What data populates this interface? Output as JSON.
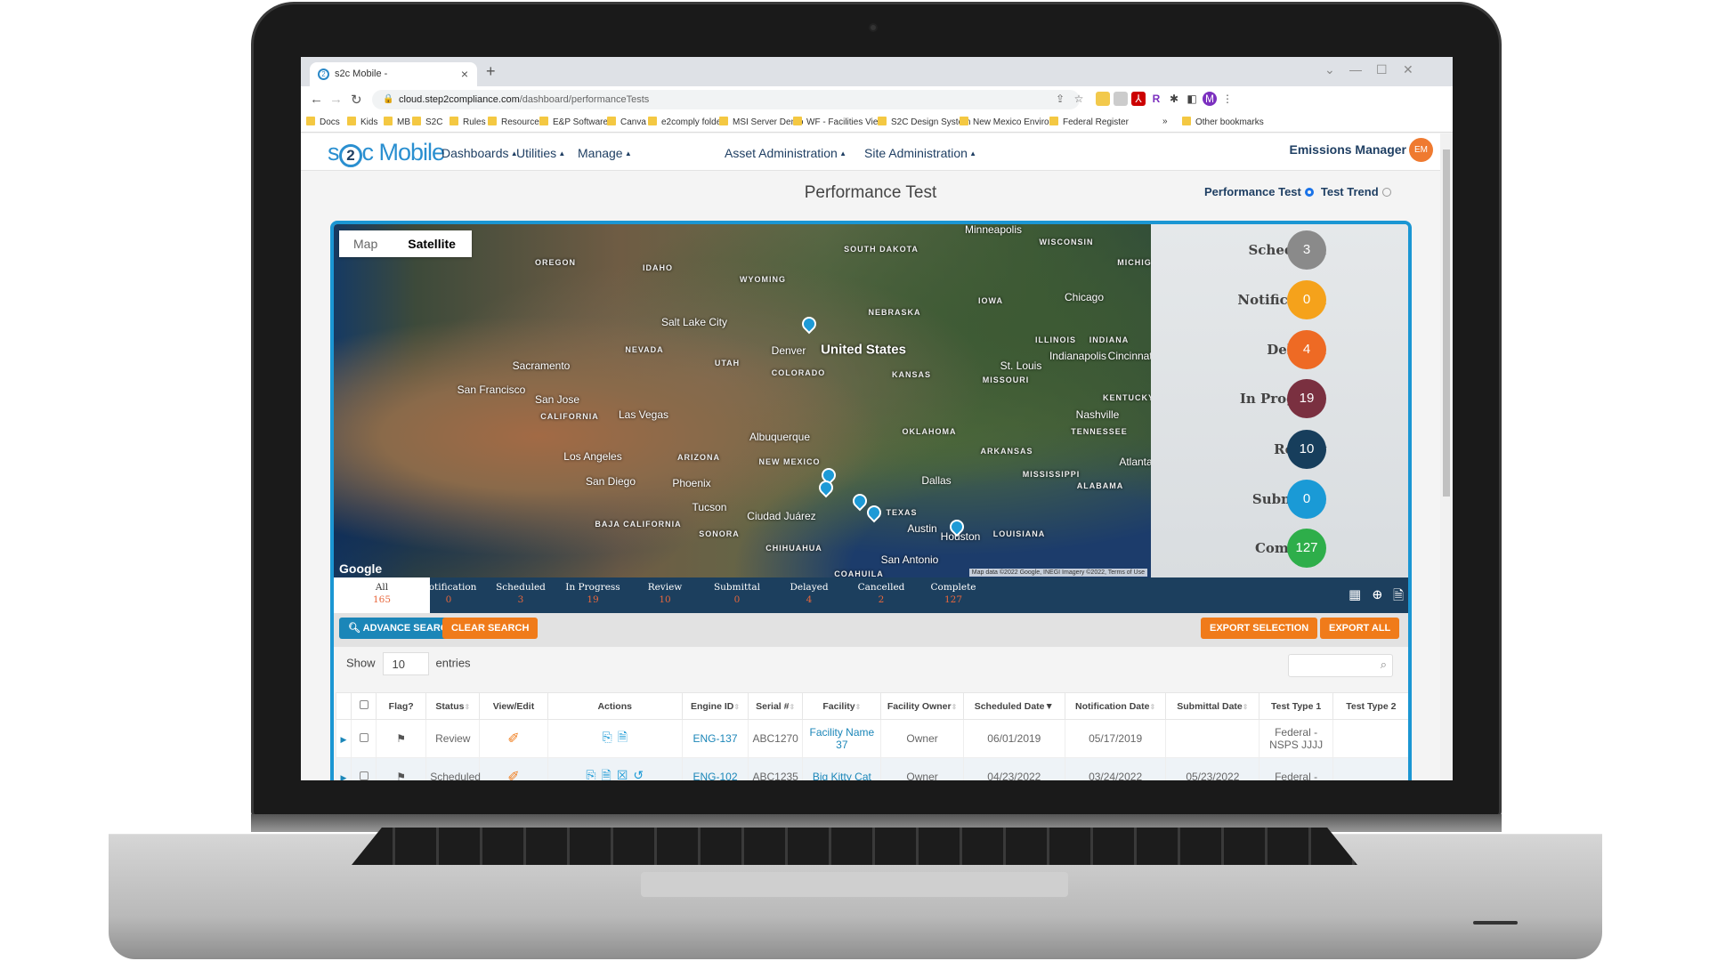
{
  "browser": {
    "tab_title": "s2c Mobile -",
    "url_domain": "cloud.step2compliance.com",
    "url_path": "/dashboard/performanceTests",
    "profile_initial": "M",
    "bookmarks": [
      "Docs",
      "Kids",
      "MB",
      "S2C",
      "Rules",
      "Resources",
      "E&P Software",
      "Canva",
      "e2comply folder",
      "MSI Server Demo",
      "WF - Facilities View",
      "S2C Design System",
      "New Mexico Enviro...",
      "Federal Register"
    ],
    "more": "»",
    "other_bookmarks": "Other bookmarks"
  },
  "app": {
    "logo_left": "s",
    "logo_mid": "2",
    "logo_right": "c Mobile",
    "nav": [
      "Dashboards",
      "Utilities",
      "Manage",
      "Asset Administration",
      "Site Administration"
    ],
    "user": "Emissions Manager",
    "avatar": "EM"
  },
  "page": {
    "title": "Performance Test",
    "view_options": [
      {
        "label": "Performance Test",
        "selected": true
      },
      {
        "label": "Test Trend",
        "selected": false
      }
    ]
  },
  "map": {
    "toggle": [
      "Map",
      "Satellite"
    ],
    "active_toggle": "Satellite",
    "attribution": "Google",
    "terms": "Map data ©2022 Google, INEGI Imagery ©2022, Terms of Use",
    "labels": [
      "United States",
      "Denver",
      "Sacramento",
      "San Francisco",
      "San Jose",
      "Las Vegas",
      "Los Angeles",
      "San Diego",
      "Phoenix",
      "Tucson",
      "Albuquerque",
      "Ciudad Juárez",
      "Dallas",
      "Austin",
      "San Antonio",
      "Houston",
      "Chicago",
      "St. Louis",
      "Indianapolis",
      "Nashville",
      "Atlanta",
      "Minneapolis",
      "Salt Lake City",
      "Cincinnati"
    ],
    "regions": [
      "OREGON",
      "IDAHO",
      "WYOMING",
      "SOUTH DAKOTA",
      "NEBRASKA",
      "IOWA",
      "WISCONSIN",
      "MICHIGAN",
      "ILLINOIS",
      "INDIANA",
      "NEVADA",
      "UTAH",
      "COLORADO",
      "KANSAS",
      "MISSOURI",
      "KENTUCKY",
      "CALIFORNIA",
      "OKLAHOMA",
      "TENNESSEE",
      "ARIZONA",
      "NEW MEXICO",
      "ARKANSAS",
      "MISSISSIPPI",
      "ALABAMA",
      "TEXAS",
      "LOUISIANA",
      "SONORA",
      "CHIHUAHUA",
      "COAHUILA",
      "BAJA CALIFORNIA"
    ],
    "pin_icon": "facility-pin-icon"
  },
  "stats": [
    {
      "label": "Scheduled",
      "count": "3",
      "color": "#8a8a8a"
    },
    {
      "label": "Notification",
      "count": "0",
      "color": "#f5a21b"
    },
    {
      "label": "Delayed",
      "count": "4",
      "color": "#ee6a24"
    },
    {
      "label": "In Progress",
      "count": "19",
      "color": "#7a3040"
    },
    {
      "label": "Review",
      "count": "10",
      "color": "#173e5c"
    },
    {
      "label": "Submittal",
      "count": "0",
      "color": "#1a9ad6"
    },
    {
      "label": "Complete",
      "count": "127",
      "color": "#2eae4a"
    }
  ],
  "filter_tabs": [
    {
      "label": "All",
      "count": "165"
    },
    {
      "label": "Notification",
      "count": "0"
    },
    {
      "label": "Scheduled",
      "count": "3"
    },
    {
      "label": "In Progress",
      "count": "19"
    },
    {
      "label": "Review",
      "count": "10"
    },
    {
      "label": "Submittal",
      "count": "0"
    },
    {
      "label": "Delayed",
      "count": "4"
    },
    {
      "label": "Cancelled",
      "count": "2"
    },
    {
      "label": "Complete",
      "count": "127"
    }
  ],
  "toolbar": {
    "advance_search": "ADVANCE SEARCH",
    "clear_search": "CLEAR SEARCH",
    "export_selection": "EXPORT SELECTION",
    "export_all": "EXPORT ALL",
    "show": "Show",
    "entries_value": "10",
    "entries": "entries",
    "search_value": ""
  },
  "table": {
    "columns": [
      "Flag?",
      "Status",
      "View/Edit",
      "Actions",
      "Engine ID",
      "Serial #",
      "Facility",
      "Facility Owner",
      "Scheduled Date",
      "Notification Date",
      "Submittal Date",
      "Test Type 1",
      "Test Type 2"
    ],
    "sorted_column": "Scheduled Date",
    "rows": [
      {
        "status": "Review",
        "engine_id": "ENG-137",
        "serial": "ABC1270",
        "facility": "Facility Name 37",
        "owner": "Owner",
        "scheduled": "06/01/2019",
        "notification": "05/17/2019",
        "submittal": "",
        "test_type_1": "Federal - NSPS JJJJ",
        "test_type_2": ""
      },
      {
        "status": "Scheduled",
        "engine_id": "ENG-102",
        "serial": "ABC1235",
        "facility": "Big Kitty Cat",
        "owner": "Owner",
        "scheduled": "04/23/2022",
        "notification": "03/24/2022",
        "submittal": "05/23/2022",
        "test_type_1": "Federal -",
        "test_type_2": ""
      }
    ]
  }
}
